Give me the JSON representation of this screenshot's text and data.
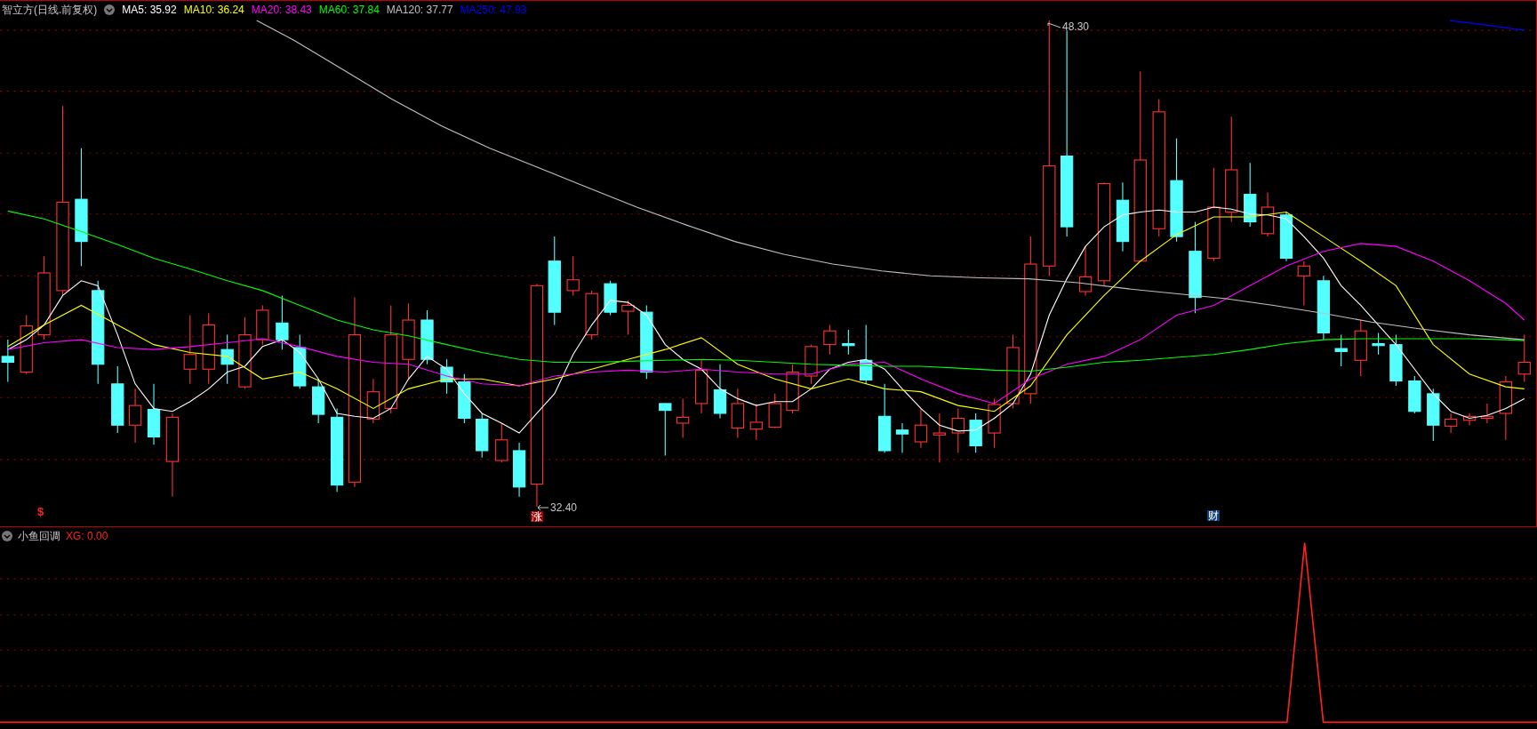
{
  "main_chart": {
    "title": "智立方(日线.前复权)",
    "legend": [
      {
        "label": "MA5: 35.92",
        "color": "#ffffff"
      },
      {
        "label": "MA10: 36.24",
        "color": "#ffff00"
      },
      {
        "label": "MA20: 38.43",
        "color": "#ff00ff"
      },
      {
        "label": "MA60: 37.84",
        "color": "#00ff00"
      },
      {
        "label": "MA120: 37.77",
        "color": "#c0c0c0"
      },
      {
        "label": "MA250: 47.93",
        "color": "#0000ff"
      }
    ],
    "high_label": "48.30",
    "low_label": "32.40",
    "markers": [
      {
        "kind": "symbol",
        "text": "$"
      },
      {
        "kind": "badge",
        "text": "涨"
      },
      {
        "kind": "badge",
        "text": "财"
      }
    ]
  },
  "indicator": {
    "title": "小鱼回调",
    "reading": "XG: 0.00"
  }
}
